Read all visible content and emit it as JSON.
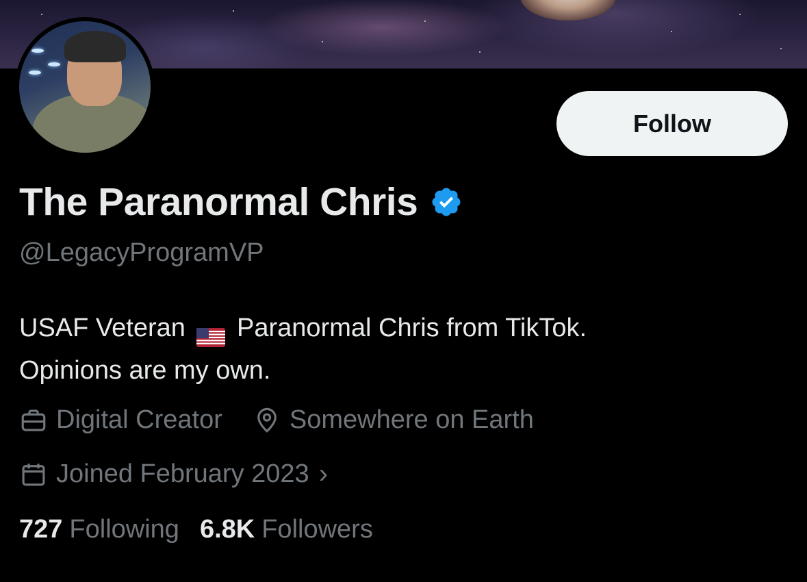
{
  "profile": {
    "display_name": "The Paranormal Chris",
    "handle": "@LegacyProgramVP",
    "verified": true,
    "bio_part1": "USAF Veteran",
    "bio_flag": "us-flag-emoji",
    "bio_part2": "Paranormal Chris from TikTok.",
    "bio_line2": "Opinions are my own.",
    "category": "Digital Creator",
    "location": "Somewhere on Earth",
    "joined": "Joined February 2023",
    "joined_chevron": "›"
  },
  "actions": {
    "follow_label": "Follow"
  },
  "stats": {
    "following_count": "727",
    "following_label": "Following",
    "followers_count": "6.8K",
    "followers_label": "Followers"
  },
  "icons": {
    "verified": "verified-badge-icon",
    "category": "briefcase-icon",
    "location": "location-pin-icon",
    "joined": "calendar-icon"
  },
  "colors": {
    "background": "#000000",
    "primary_text": "#e7e9ea",
    "secondary_text": "#71767b",
    "verified_blue": "#1d9bf0",
    "follow_button_bg": "#eff3f4"
  }
}
